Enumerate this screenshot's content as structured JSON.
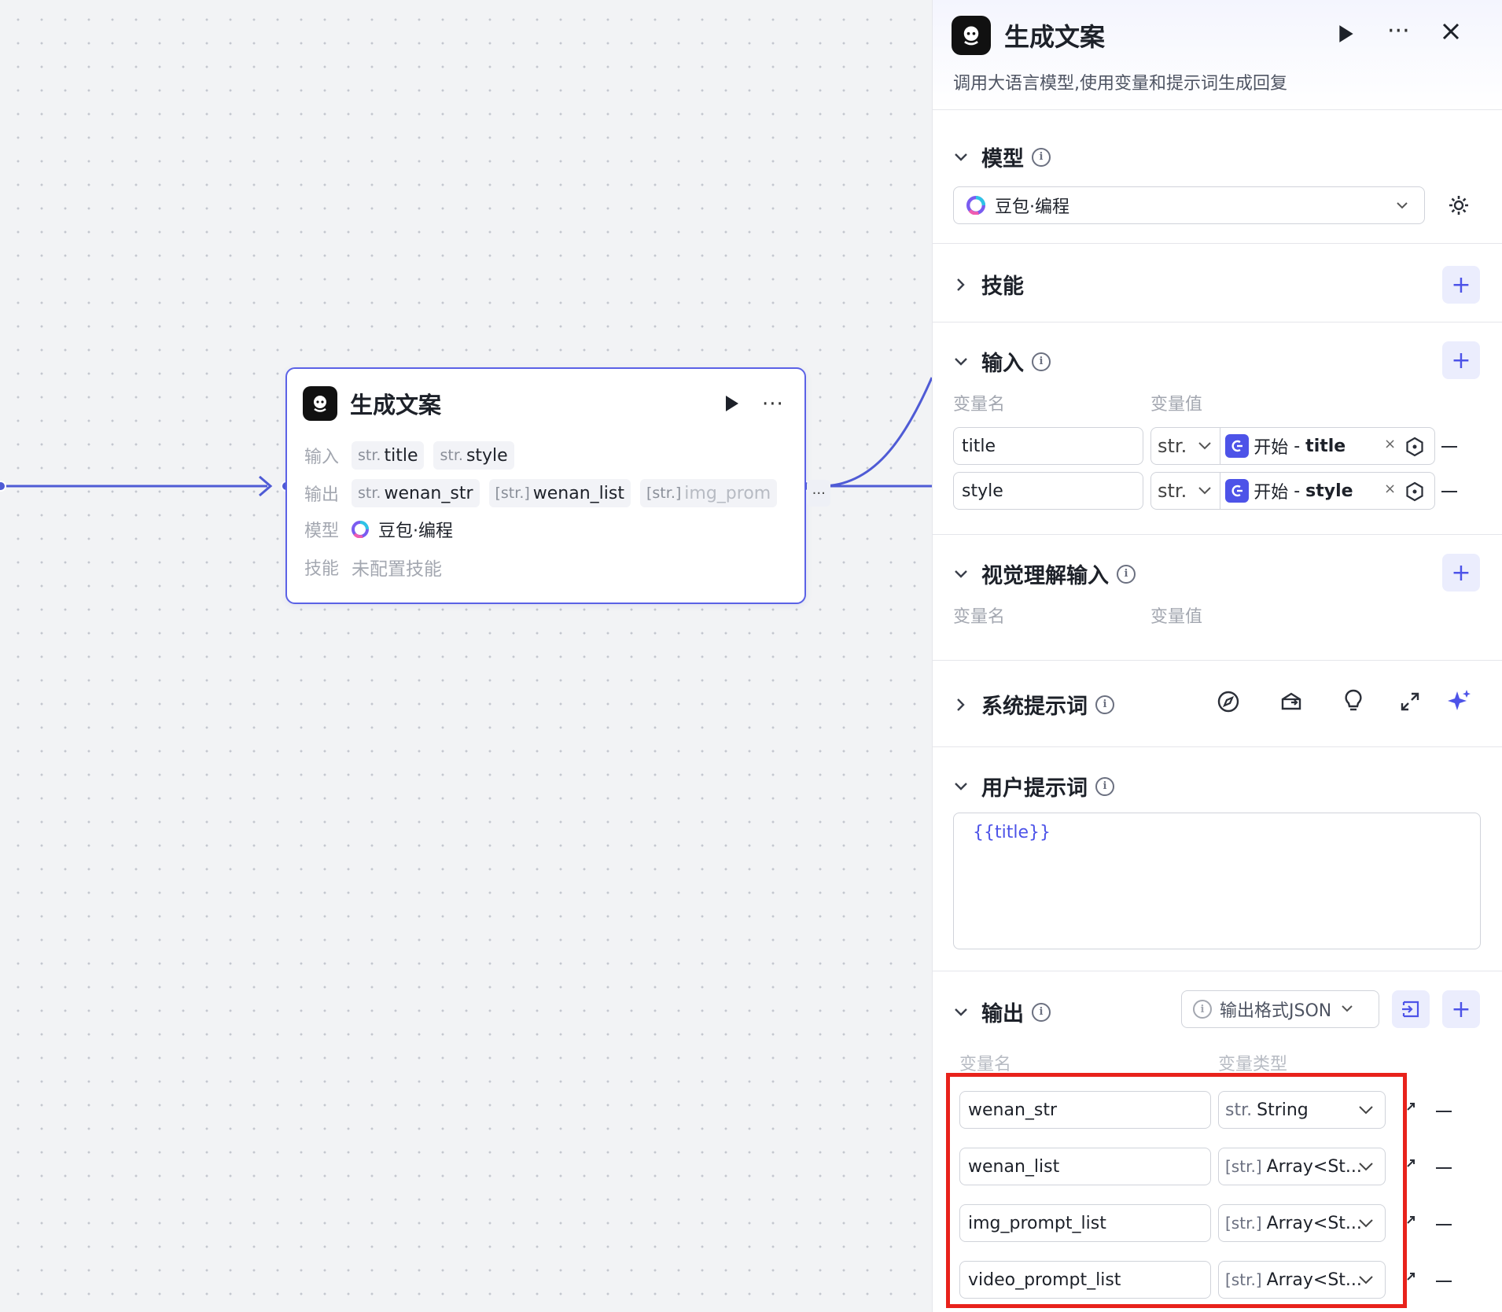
{
  "node": {
    "title": "生成文案",
    "input_label": "输入",
    "inputs": [
      {
        "type": "str.",
        "name": "title"
      },
      {
        "type": "str.",
        "name": "style"
      }
    ],
    "output_label": "输出",
    "outputs": [
      {
        "type": "str.",
        "name": "wenan_str"
      },
      {
        "type": "[str.]",
        "name": "wenan_list"
      },
      {
        "type": "[str.]",
        "name": "img_prom"
      }
    ],
    "more_outputs": "···",
    "model_label": "模型",
    "model_value": "豆包·编程",
    "skill_label": "技能",
    "skill_value": "未配置技能"
  },
  "panel": {
    "title": "生成文案",
    "description": "调用大语言模型,使用变量和提示词生成回复",
    "model": {
      "heading": "模型",
      "selected": "豆包·编程"
    },
    "skills": {
      "heading": "技能"
    },
    "input": {
      "heading": "输入",
      "col_name": "变量名",
      "col_value": "变量值",
      "rows": [
        {
          "name": "title",
          "type": "str.",
          "ref_source": "开始",
          "ref_sep": " - ",
          "ref_var": "title"
        },
        {
          "name": "style",
          "type": "str.",
          "ref_source": "开始",
          "ref_sep": " - ",
          "ref_var": "style"
        }
      ]
    },
    "vision_input": {
      "heading": "视觉理解输入",
      "col_name": "变量名",
      "col_value": "变量值"
    },
    "system_prompt": {
      "heading": "系统提示词"
    },
    "user_prompt": {
      "heading": "用户提示词",
      "content": "{{title}}"
    },
    "output": {
      "heading": "输出",
      "format_label": "输出格式JSON",
      "col_name": "变量名",
      "col_type": "变量类型",
      "rows": [
        {
          "name": "wenan_str",
          "type_prefix": "str.",
          "type": "String"
        },
        {
          "name": "wenan_list",
          "type_prefix": "[str.]",
          "type": "Array<St..."
        },
        {
          "name": "img_prompt_list",
          "type_prefix": "[str.]",
          "type": "Array<St..."
        },
        {
          "name": "video_prompt_list",
          "type_prefix": "[str.]",
          "type": "Array<St..."
        }
      ]
    }
  },
  "colors": {
    "accent": "#4d53e8",
    "highlight": "#e8221b",
    "edge": "#4f5bd5"
  }
}
